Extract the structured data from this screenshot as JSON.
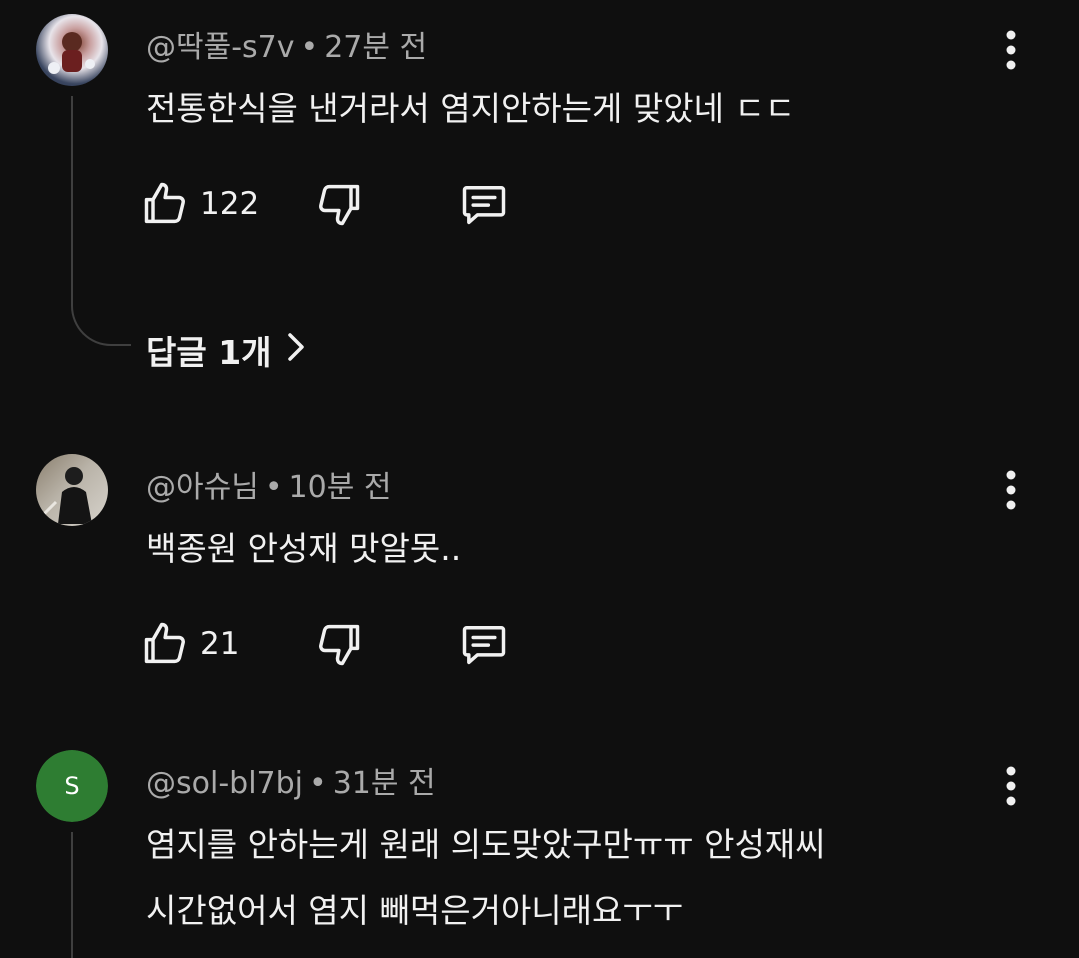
{
  "comments": [
    {
      "author": "@딱풀-s7v",
      "time": "27분 전",
      "separator": "•",
      "lines": [
        "전통한식을 낸거라서 염지안하는게 맞았네 ㄷㄷ"
      ],
      "likes": "122",
      "replies_label": "답글 1개",
      "avatar_icon": "user-avatar-illustration"
    },
    {
      "author": "@아슈님",
      "time": "10분 전",
      "separator": "•",
      "lines": [
        "백종원 안성재 맛알못.."
      ],
      "likes": "21",
      "avatar_icon": "user-avatar-photo"
    },
    {
      "author": "@sol-bl7bj",
      "time": "31분 전",
      "separator": "•",
      "lines": [
        "염지를 안하는게 원래 의도맞았구만ㅠㅠ 안성재씨",
        "시간없어서 염지 빼먹은거아니래요ㅜㅜ"
      ],
      "avatar_letter": "S",
      "avatar_color": "#2e7d32"
    }
  ],
  "colors": {
    "background": "#0f0f0f",
    "primary_text": "#f1f1f1",
    "secondary_text": "#aaaaaa",
    "thread_line": "#3f3f3f"
  }
}
